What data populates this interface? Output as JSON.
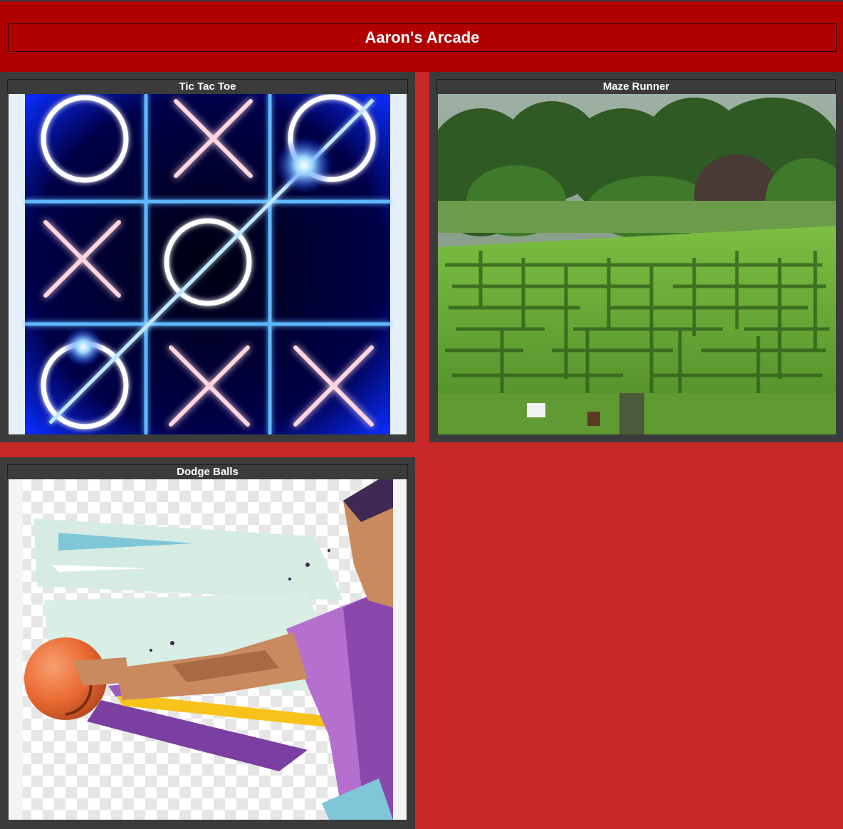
{
  "header": {
    "title": "Aaron's Arcade"
  },
  "games": [
    {
      "title": "Tic Tac Toe",
      "image": "tic-tac-toe neon board",
      "board": [
        "O",
        "X",
        "O",
        "X",
        "O",
        "",
        "O",
        "X",
        "X"
      ]
    },
    {
      "title": "Maze Runner",
      "image": "hedge maze photo"
    },
    {
      "title": "Dodge Balls",
      "image": "illustrated player throwing dodgeball"
    }
  ],
  "colors": {
    "page_bg": "#c62828",
    "header_bg": "#b00000",
    "card_bg": "#3b3b3b",
    "neon_blue": "#1e6bff",
    "neon_red": "#ff1a3a",
    "maze_green": "#6fa83a"
  }
}
